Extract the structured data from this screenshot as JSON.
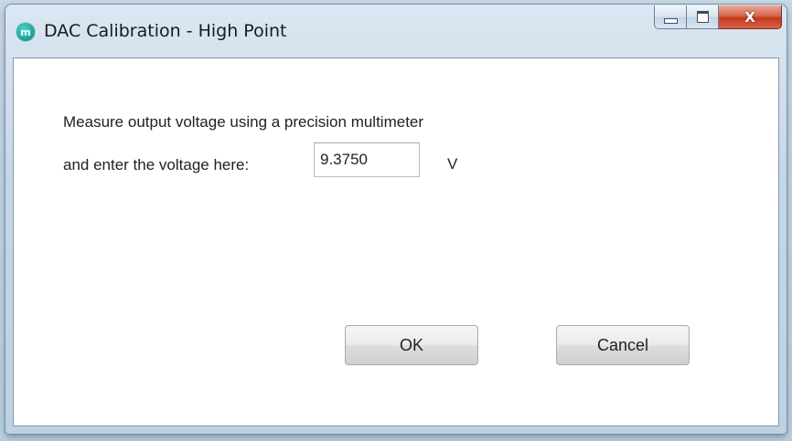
{
  "window": {
    "title": "DAC Calibration - High Point",
    "app_icon_glyph": "m",
    "caption_buttons": {
      "minimize_icon": "minimize-icon",
      "maximize_icon": "maximize-icon",
      "close_glyph": "X"
    }
  },
  "dialog": {
    "instruction_line1": "Measure output voltage using a precision multimeter",
    "instruction_line2": "and enter the voltage here:",
    "voltage_value": "9.3750",
    "unit_label": "V",
    "ok_label": "OK",
    "cancel_label": "Cancel"
  },
  "colors": {
    "close_button": "#c2391c",
    "app_icon": "#19a99e"
  }
}
